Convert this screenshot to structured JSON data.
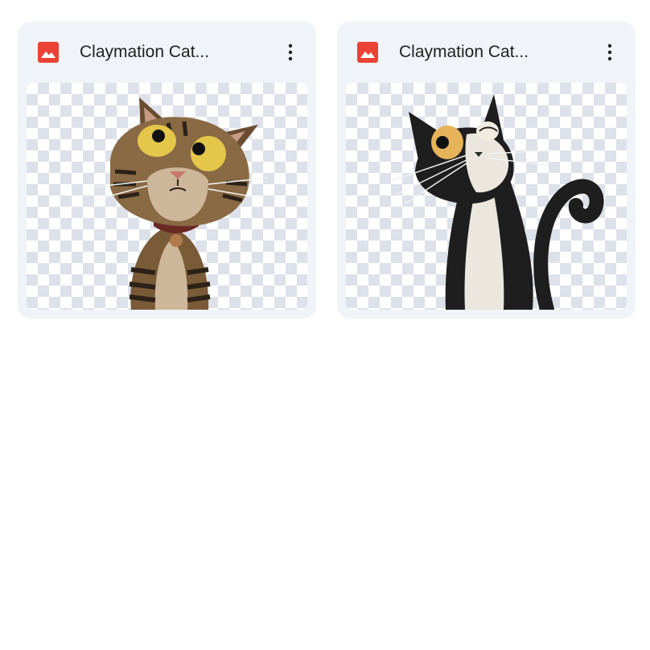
{
  "files": [
    {
      "title": "Claymation Cat...",
      "icon": "image-file-icon",
      "icon_color": "#ea4335",
      "thumbnail": "tabby-claymation-cat-image"
    },
    {
      "title": "Claymation Cat...",
      "icon": "image-file-icon",
      "icon_color": "#ea4335",
      "thumbnail": "tuxedo-claymation-cat-image"
    }
  ]
}
